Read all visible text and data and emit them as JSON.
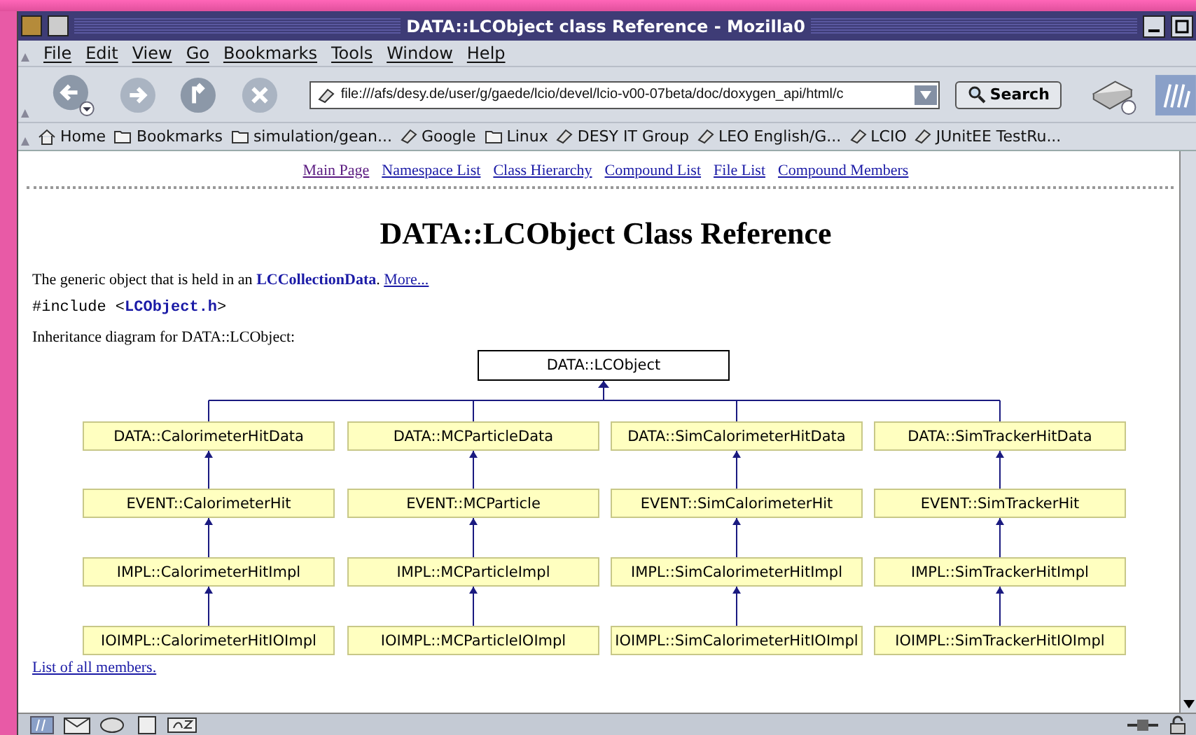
{
  "window": {
    "title": "DATA::LCObject class Reference - Mozilla0"
  },
  "menu": [
    "File",
    "Edit",
    "View",
    "Go",
    "Bookmarks",
    "Tools",
    "Window",
    "Help"
  ],
  "url": "file:///afs/desy.de/user/g/gaede/lcio/devel/lcio-v00-07beta/doc/doxygen_api/html/c",
  "search_button": "Search",
  "bookmarks": [
    {
      "kind": "home",
      "label": "Home"
    },
    {
      "kind": "folder",
      "label": "Bookmarks"
    },
    {
      "kind": "folder",
      "label": "simulation/gean..."
    },
    {
      "kind": "link",
      "label": "Google"
    },
    {
      "kind": "folder",
      "label": "Linux"
    },
    {
      "kind": "link",
      "label": "DESY IT Group"
    },
    {
      "kind": "link",
      "label": "LEO English/G..."
    },
    {
      "kind": "link",
      "label": "LCIO"
    },
    {
      "kind": "link",
      "label": "JUnitEE TestRu..."
    }
  ],
  "nav_links": [
    "Main Page",
    "Namespace List",
    "Class Hierarchy",
    "Compound List",
    "File List",
    "Compound Members"
  ],
  "heading": "DATA::LCObject Class Reference",
  "description": {
    "text": "The generic object that is held in an",
    "link": "LCCollectionData",
    "after": ".",
    "more": "More..."
  },
  "include": {
    "before": "#include <",
    "file": "LCObject.h",
    "after": ">"
  },
  "diagram_caption": "Inheritance diagram for DATA::LCObject:",
  "diagram": {
    "label": "DATA::LCObject",
    "children": [
      {
        "label": "DATA::CalorimeterHitData",
        "children": [
          {
            "label": "EVENT::CalorimeterHit",
            "children": [
              {
                "label": "IMPL::CalorimeterHitImpl",
                "children": [
                  {
                    "label": "IOIMPL::CalorimeterHitIOImpl"
                  }
                ]
              }
            ]
          }
        ]
      },
      {
        "label": "DATA::MCParticleData",
        "children": [
          {
            "label": "EVENT::MCParticle",
            "children": [
              {
                "label": "IMPL::MCParticleImpl",
                "children": [
                  {
                    "label": "IOIMPL::MCParticleIOImpl"
                  }
                ]
              }
            ]
          }
        ]
      },
      {
        "label": "DATA::SimCalorimeterHitData",
        "children": [
          {
            "label": "EVENT::SimCalorimeterHit",
            "children": [
              {
                "label": "IMPL::SimCalorimeterHitImpl",
                "children": [
                  {
                    "label": "IOIMPL::SimCalorimeterHitIOImpl"
                  }
                ]
              }
            ]
          }
        ]
      },
      {
        "label": "DATA::SimTrackerHitData",
        "children": [
          {
            "label": "EVENT::SimTrackerHit",
            "children": [
              {
                "label": "IMPL::SimTrackerHitImpl",
                "children": [
                  {
                    "label": "IOIMPL::SimTrackerHitIOImpl"
                  }
                ]
              }
            ]
          }
        ]
      }
    ]
  },
  "members_link": "List of all members."
}
